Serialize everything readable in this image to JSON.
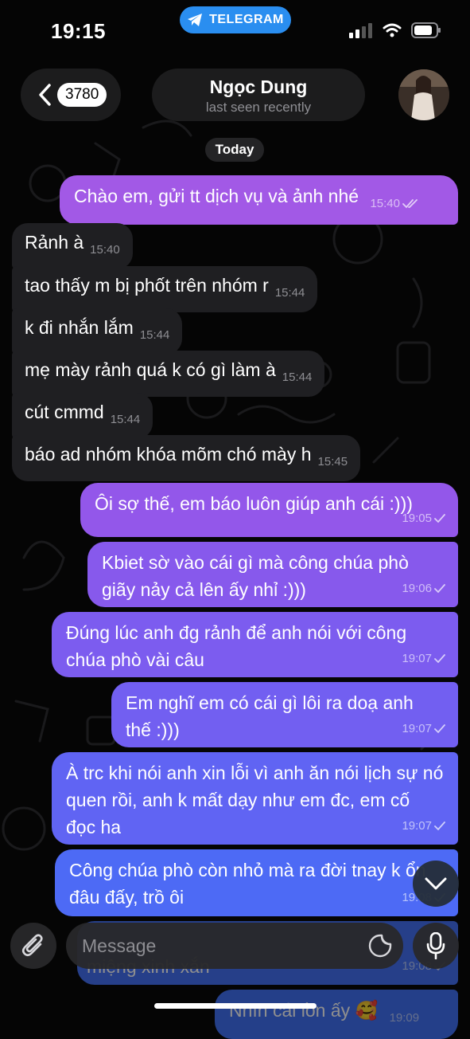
{
  "status_bar": {
    "time": "19:15",
    "app_pill": "TELEGRAM"
  },
  "header": {
    "back_count": "3780",
    "chat_name": "Ngọc Dung",
    "chat_status": "last seen recently"
  },
  "date_separator": "Today",
  "messages": [
    {
      "dir": "out",
      "text": "Chào em, gửi tt dịch vụ và ảnh nhé",
      "time": "15:40",
      "status": "read"
    },
    {
      "dir": "in",
      "text": "Rảnh à",
      "time": "15:40"
    },
    {
      "dir": "in",
      "text": "tao thấy m bị phốt trên nhóm r",
      "time": "15:44"
    },
    {
      "dir": "in",
      "text": "k đi nhắn lắm",
      "time": "15:44"
    },
    {
      "dir": "in",
      "text": "mẹ mày rảnh quá k có gì làm à",
      "time": "15:44"
    },
    {
      "dir": "in",
      "text": "cút cmmd",
      "time": "15:44"
    },
    {
      "dir": "in",
      "text": "báo ad nhóm khóa mõm chó mày h",
      "time": "15:45"
    },
    {
      "dir": "out",
      "text": "Ôi sợ thế, em báo luôn giúp anh cái :)))",
      "time": "19:05",
      "status": "sent"
    },
    {
      "dir": "out",
      "text": "Kbiet sờ vào cái gì mà công chúa phò giãy nảy cả lên ấy nhỉ :)))",
      "time": "19:06",
      "status": "sent"
    },
    {
      "dir": "out",
      "text": "Đúng lúc anh đg rảnh để anh nói với công chúa phò vài câu",
      "time": "19:07",
      "status": "sent"
    },
    {
      "dir": "out",
      "text": "Em nghĩ em có cái gì lôi ra doạ anh thế :)))",
      "time": "19:07",
      "status": "sent"
    },
    {
      "dir": "out",
      "text": "À trc khi nói anh xin lỗi vì anh ăn nói lịch sự nó quen rồi, anh k mất dạy như em đc, em cố đọc ha",
      "time": "19:07",
      "status": "sent"
    },
    {
      "dir": "out",
      "text": "Công chúa phò còn nhỏ mà ra đời tnay k ổn đâu đấy, trồ ôi",
      "time": "19:08",
      "status": "sent"
    },
    {
      "dir": "out",
      "text": "miệng xinh xắn",
      "time": "19:08",
      "status": "sent"
    },
    {
      "dir": "out",
      "text": "Nhìn cái lồn ấy 🥰",
      "time": "19:09",
      "status": "sent"
    }
  ],
  "input": {
    "placeholder": "Message"
  },
  "icons": {
    "back": "chevron-left-icon",
    "attach": "paperclip-icon",
    "sticker": "sticker-icon",
    "mic": "microphone-icon",
    "scroll": "chevron-down-icon"
  },
  "colors": {
    "outgoing_top": "#a259e6",
    "outgoing_bottom": "#3f6ff5",
    "incoming": "#1f1f22",
    "accent": "#2a8ef0"
  }
}
